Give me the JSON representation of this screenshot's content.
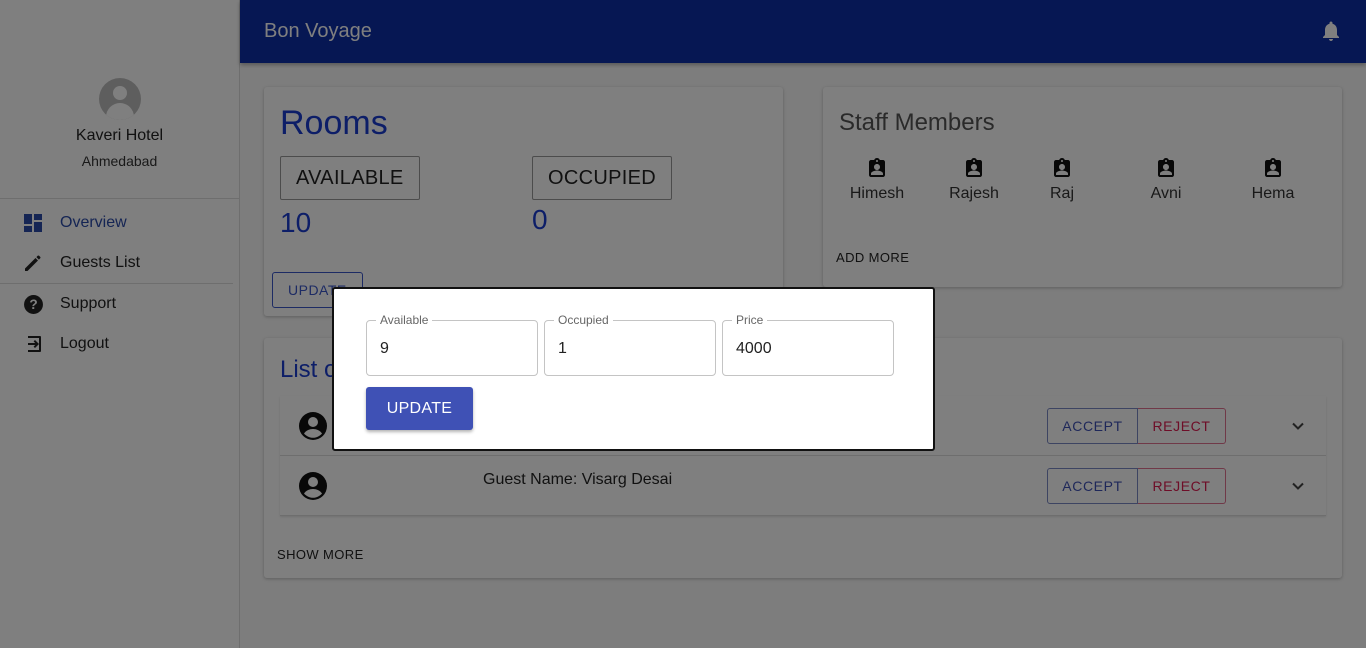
{
  "app": {
    "title": "Bon Voyage"
  },
  "profile": {
    "name": "Kaveri Hotel",
    "city": "Ahmedabad"
  },
  "nav": {
    "items": [
      {
        "label": "Overview",
        "icon": "dashboard-icon",
        "active": true
      },
      {
        "label": "Guests List",
        "icon": "pencil-icon"
      },
      {
        "label": "Support",
        "icon": "help-icon"
      },
      {
        "label": "Logout",
        "icon": "logout-icon"
      }
    ]
  },
  "rooms": {
    "title": "Rooms",
    "available_label": "AVAILABLE",
    "available_value": "10",
    "occupied_label": "OCCUPIED",
    "occupied_value": "0",
    "update_label": "UPDATE"
  },
  "staff": {
    "title": "Staff Members",
    "members": [
      "Himesh",
      "Rajesh",
      "Raj",
      "Avni",
      "Hema"
    ],
    "add_more_label": "ADD MORE"
  },
  "requests": {
    "title_visible": "List o",
    "rows": [
      {
        "name": "",
        "accept_label": "ACCEPT",
        "reject_label": "REJECT"
      },
      {
        "name": "Guest Name: Visarg Desai",
        "accept_label": "ACCEPT",
        "reject_label": "REJECT"
      }
    ],
    "show_more_label": "SHOW MORE"
  },
  "modal": {
    "fields": [
      {
        "label": "Available",
        "value": "9"
      },
      {
        "label": "Occupied",
        "value": "1"
      },
      {
        "label": "Price",
        "value": "4000"
      }
    ],
    "update_label": "UPDATE"
  },
  "colors": {
    "appbar": "#0d2fa6",
    "primary": "#3f51b5",
    "accent_text": "#1a3dd0",
    "reject": "#dc1d50"
  }
}
